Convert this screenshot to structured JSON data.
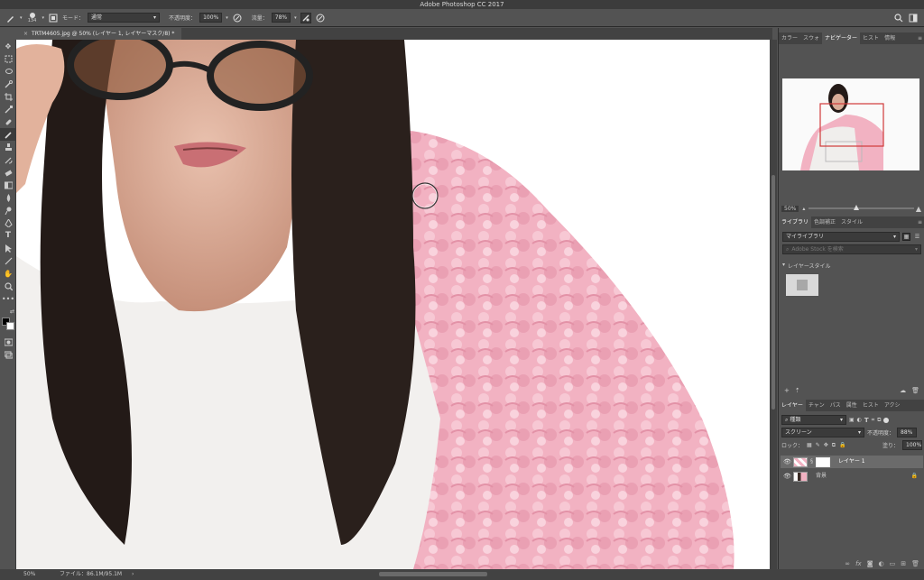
{
  "app": {
    "title": "Adobe Photoshop CC 2017"
  },
  "options": {
    "brush_size": "134",
    "mode_label": "モード：",
    "mode_value": "通常",
    "opacity_label": "不透明度：",
    "opacity_value": "100%",
    "flow_label": "流量：",
    "flow_value": "78%"
  },
  "doc_tab": {
    "title": "TRTM4605.jpg @ 50% (レイヤー 1, レイヤーマスク/8) *"
  },
  "top_panel": {
    "tabs": [
      "カラー",
      "スウォ",
      "ナビゲーター",
      "ヒスト",
      "情報"
    ],
    "zoom": "50%"
  },
  "library_panel": {
    "tabs": [
      "ライブラリ",
      "色調補正",
      "スタイル"
    ],
    "library_select": "マイライブラリ",
    "search_placeholder": "Adobe Stock を検索",
    "section_label": "レイヤースタイル"
  },
  "layers_panel": {
    "tabs": [
      "レイヤー",
      "チャン",
      "パス",
      "属性",
      "ヒスト",
      "アクシ"
    ],
    "kind_filter": "種類",
    "blend_mode": "スクリーン",
    "opacity_label": "不透明度：",
    "opacity_value": "88%",
    "lock_label": "ロック：",
    "fill_label": "塗り：",
    "fill_value": "100%",
    "layers": [
      {
        "name": "レイヤー 1"
      },
      {
        "name": "背景"
      }
    ]
  },
  "status": {
    "zoom": "50%",
    "file_info": "ファイル：86.1M/95.1M"
  },
  "colors": {
    "accent": "#d03a3a",
    "bg": "#535353",
    "dark": "#424242",
    "pink": "#f2b2c2"
  }
}
